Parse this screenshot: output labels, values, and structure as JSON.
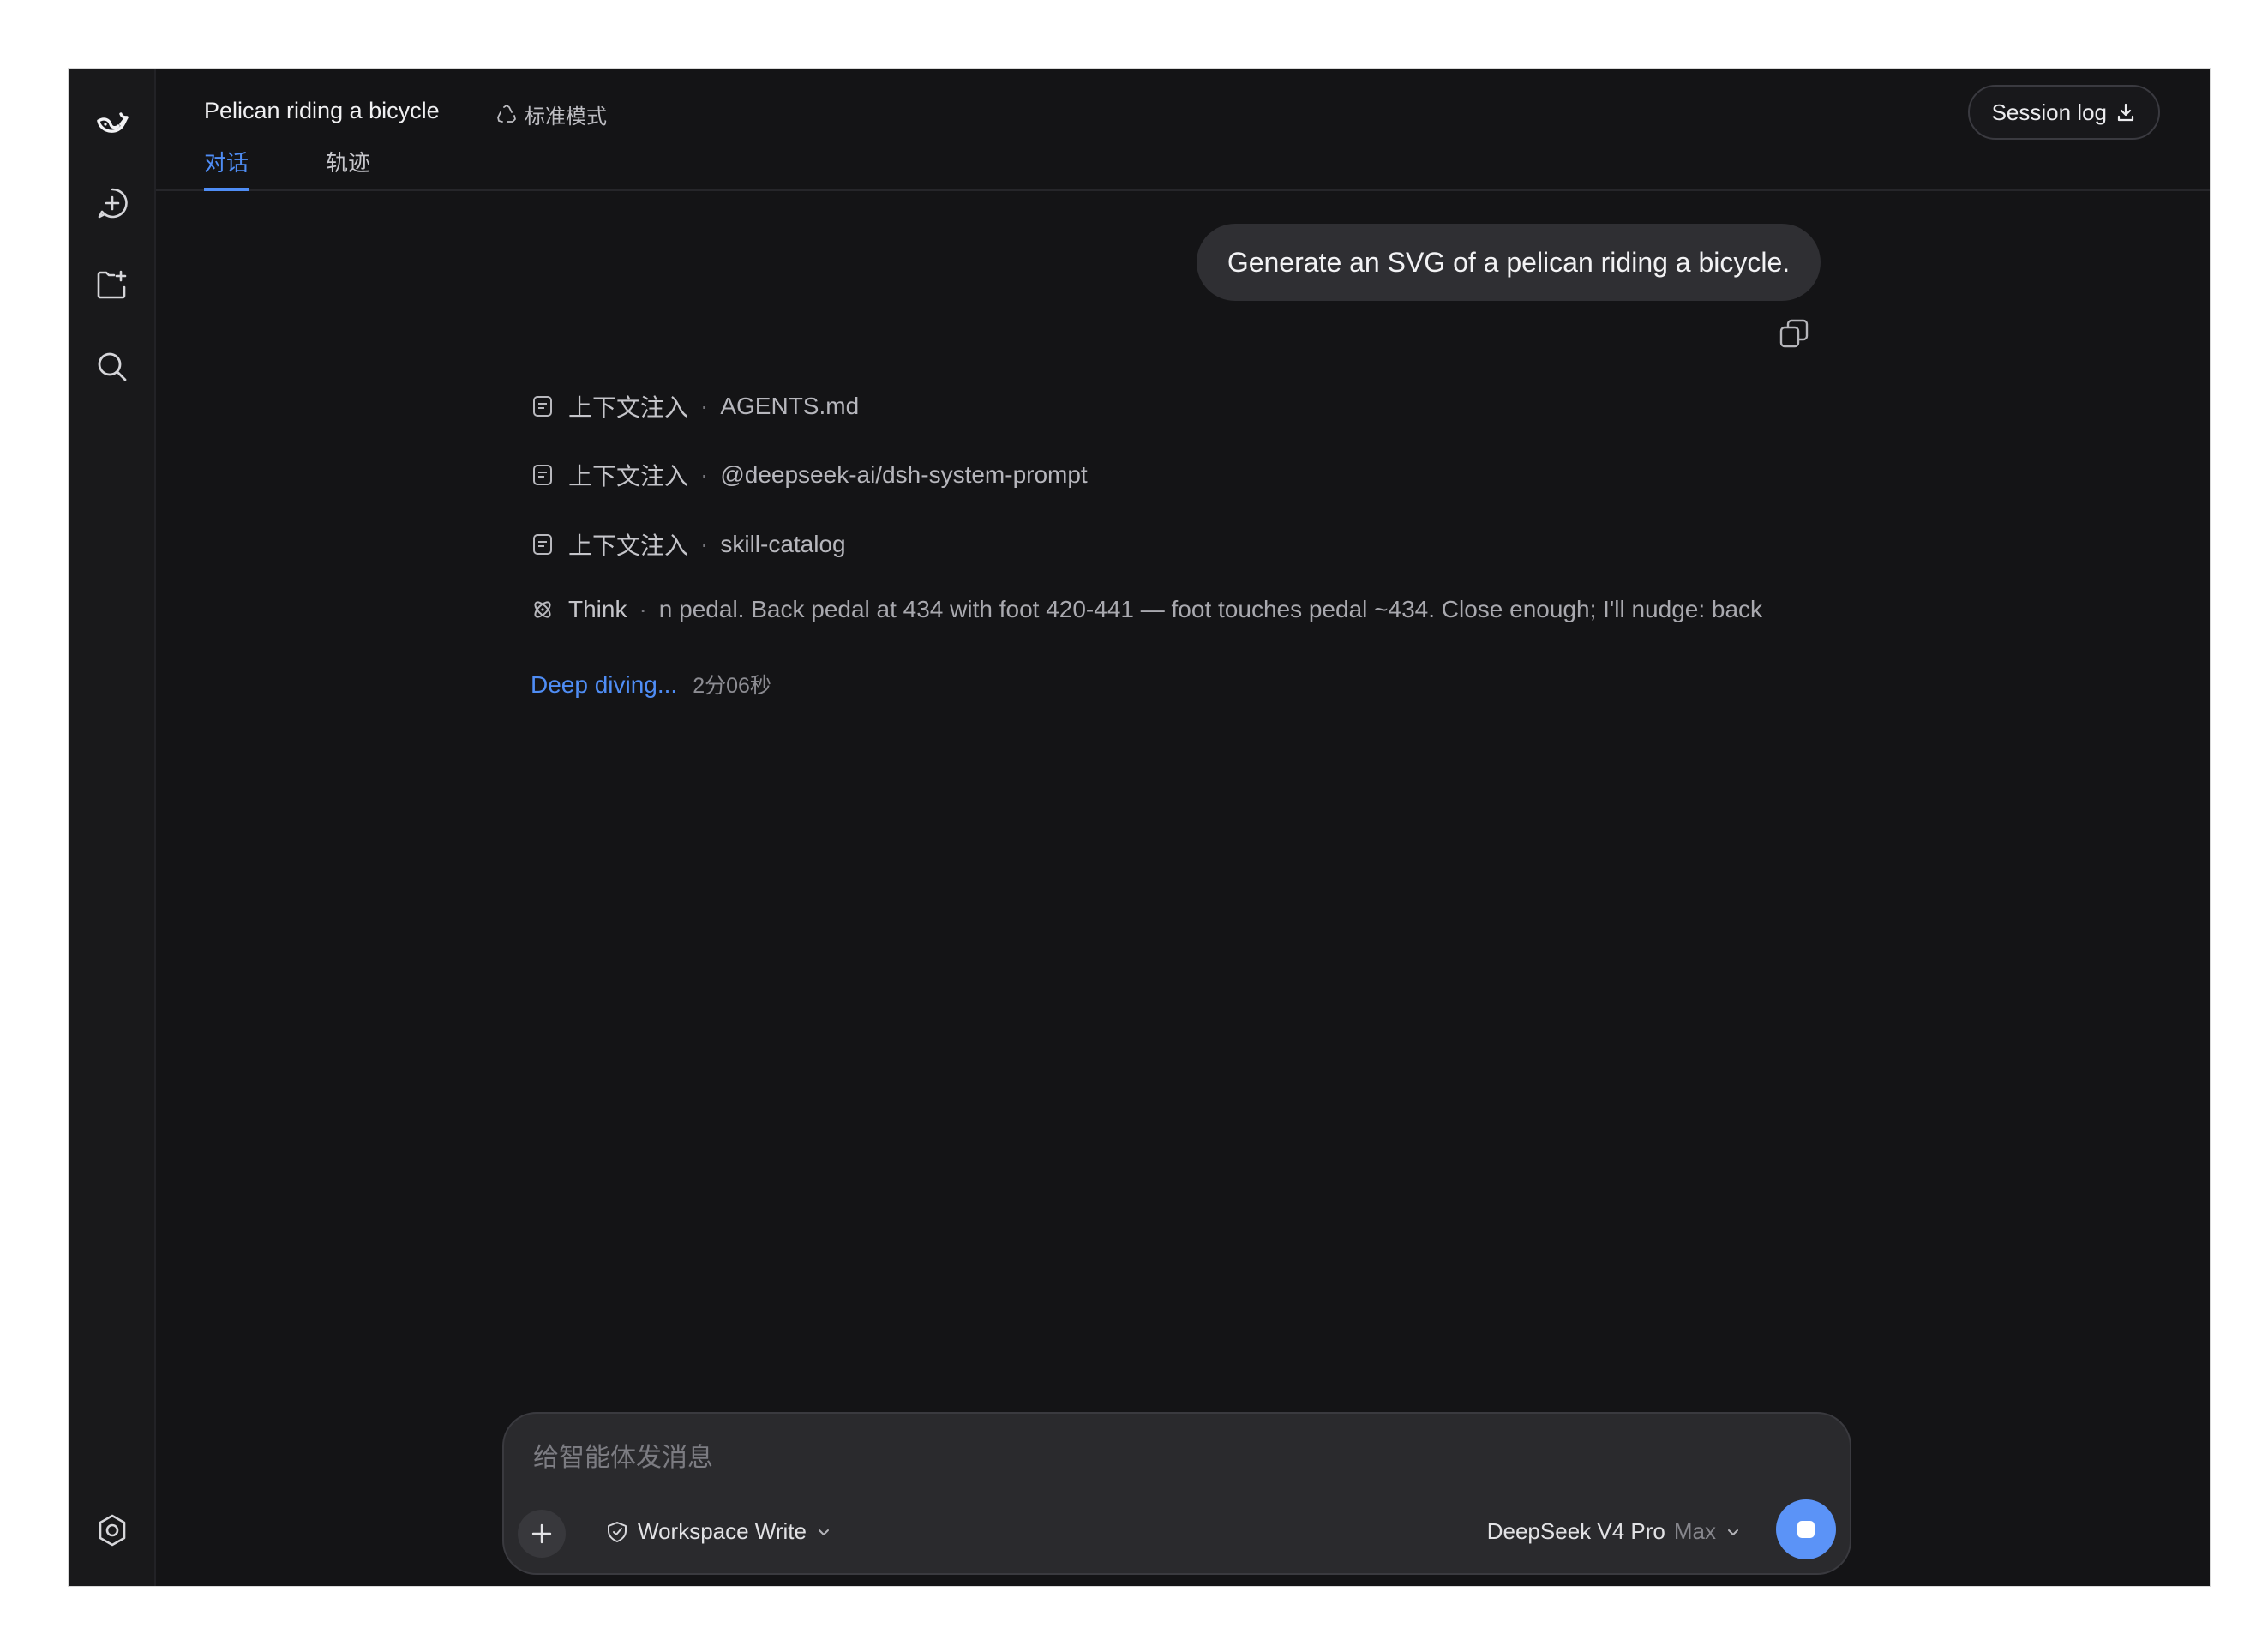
{
  "sidebar": {
    "icons": [
      "whale-logo-icon",
      "new-chat-icon",
      "new-project-icon",
      "search-icon",
      "settings-icon"
    ]
  },
  "header": {
    "title": "Pelican riding a bicycle",
    "mode_label": "标准模式",
    "tabs": [
      {
        "label": "对话",
        "active": true
      },
      {
        "label": "轨迹",
        "active": false
      }
    ],
    "session_log_label": "Session log"
  },
  "chat": {
    "user_message": "Generate an SVG of a pelican riding a bicycle.",
    "steps": [
      {
        "label": "上下文注入",
        "detail": "AGENTS.md"
      },
      {
        "label": "上下文注入",
        "detail": "@deepseek-ai/dsh-system-prompt"
      },
      {
        "label": "上下文注入",
        "detail": "skill-catalog"
      }
    ],
    "think": {
      "label": "Think",
      "text": "n pedal. Back pedal at 434 with foot 420-441 — foot touches pedal ~434. Close enough; I'll nudge: back"
    },
    "status": {
      "label": "Deep diving...",
      "elapsed": "2分06秒"
    },
    "separator": "·"
  },
  "composer": {
    "placeholder": "给智能体发消息",
    "value": "",
    "permission_label": "Workspace Write",
    "model_name": "DeepSeek V4 Pro",
    "model_tier": "Max"
  },
  "colors": {
    "accent": "#4f8df5",
    "stop_button": "#5b93f7",
    "background": "#141416",
    "bubble": "#2f2f33"
  }
}
